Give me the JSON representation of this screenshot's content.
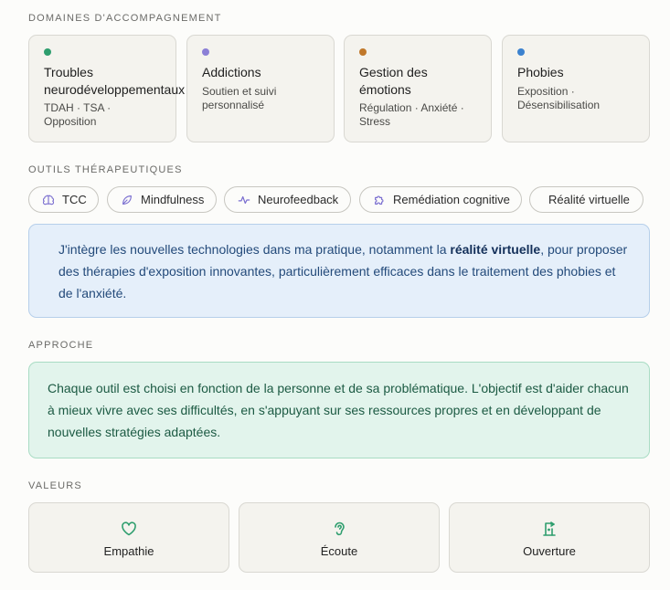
{
  "domains": {
    "title": "DOMAINES D'ACCOMPAGNEMENT",
    "items": [
      {
        "title_line1": "Troubles",
        "title_line2": "neurodéveloppementaux",
        "subtitle": "TDAH · TSA · Opposition",
        "color": "#2e9e6e"
      },
      {
        "title_line1": "Addictions",
        "title_line2": "",
        "subtitle": "Soutien et suivi personnalisé",
        "color": "#8b7fd6"
      },
      {
        "title_line1": "Gestion des",
        "title_line2": "émotions",
        "subtitle": "Régulation · Anxiété · Stress",
        "color": "#c0782a"
      },
      {
        "title_line1": "Phobies",
        "title_line2": "",
        "subtitle": "Exposition · Désensibilisation",
        "color": "#3b82cf"
      }
    ]
  },
  "tools": {
    "title": "OUTILS THÉRAPEUTIQUES",
    "items": [
      {
        "label": "TCC",
        "icon": "brain-icon"
      },
      {
        "label": "Mindfulness",
        "icon": "leaf-icon"
      },
      {
        "label": "Neurofeedback",
        "icon": "pulse-icon"
      },
      {
        "label": "Remédiation cognitive",
        "icon": "puzzle-icon"
      },
      {
        "label": "Réalité virtuelle",
        "icon": "vr-headset-icon"
      }
    ],
    "accent": "#7b6fd0"
  },
  "vr_note": {
    "before": "J'intègre les nouvelles technologies dans ma pratique, notamment la ",
    "bold": "réalité virtuelle",
    "after": ", pour proposer des thérapies d'exposition innovantes, particulièrement efficaces dans le traitement des phobies et de l'anxiété."
  },
  "approach": {
    "title": "APPROCHE",
    "text": "Chaque outil est choisi en fonction de la personne et de sa problématique. L'objectif est d'aider chacun à mieux vivre avec ses difficultés, en s'appuyant sur ses ressources propres et en développant de nouvelles stratégies adaptées."
  },
  "values": {
    "title": "VALEURS",
    "items": [
      {
        "label": "Empathie",
        "icon": "heart-icon"
      },
      {
        "label": "Écoute",
        "icon": "ear-icon"
      },
      {
        "label": "Ouverture",
        "icon": "open-door-icon"
      }
    ],
    "accent": "#2e9e6e"
  }
}
